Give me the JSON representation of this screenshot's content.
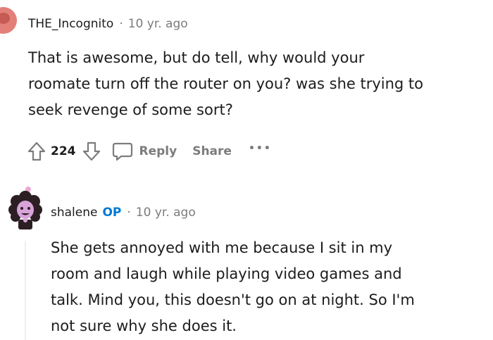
{
  "comments": [
    {
      "username": "THE_Incognito",
      "separator": "·",
      "time": "10 yr. ago",
      "lines": [
        "That is awesome, but do tell, why would your",
        "roomate turn off the router on you? was she trying to",
        "seek revenge of some sort?"
      ],
      "votes": "224",
      "reply_label": "Reply",
      "share_label": "Share",
      "more_label": "•••"
    },
    {
      "username": "shalene",
      "op_badge": "OP",
      "separator": "·",
      "time": "10 yr. ago",
      "lines": [
        "She gets annoyed with me because I sit in my",
        "room and laugh while playing video games and",
        "talk. Mind you, this doesn't go on at night. So I'm",
        "not sure why she does it."
      ]
    }
  ],
  "icons": {
    "upvote": "upvote-icon",
    "downvote": "downvote-icon",
    "reply": "comment-bubble-icon",
    "more": "more-options-icon"
  },
  "colors": {
    "op_badge": "#0079d3",
    "meta_gray": "#7c7c7c",
    "text": "#1c1c1c"
  }
}
